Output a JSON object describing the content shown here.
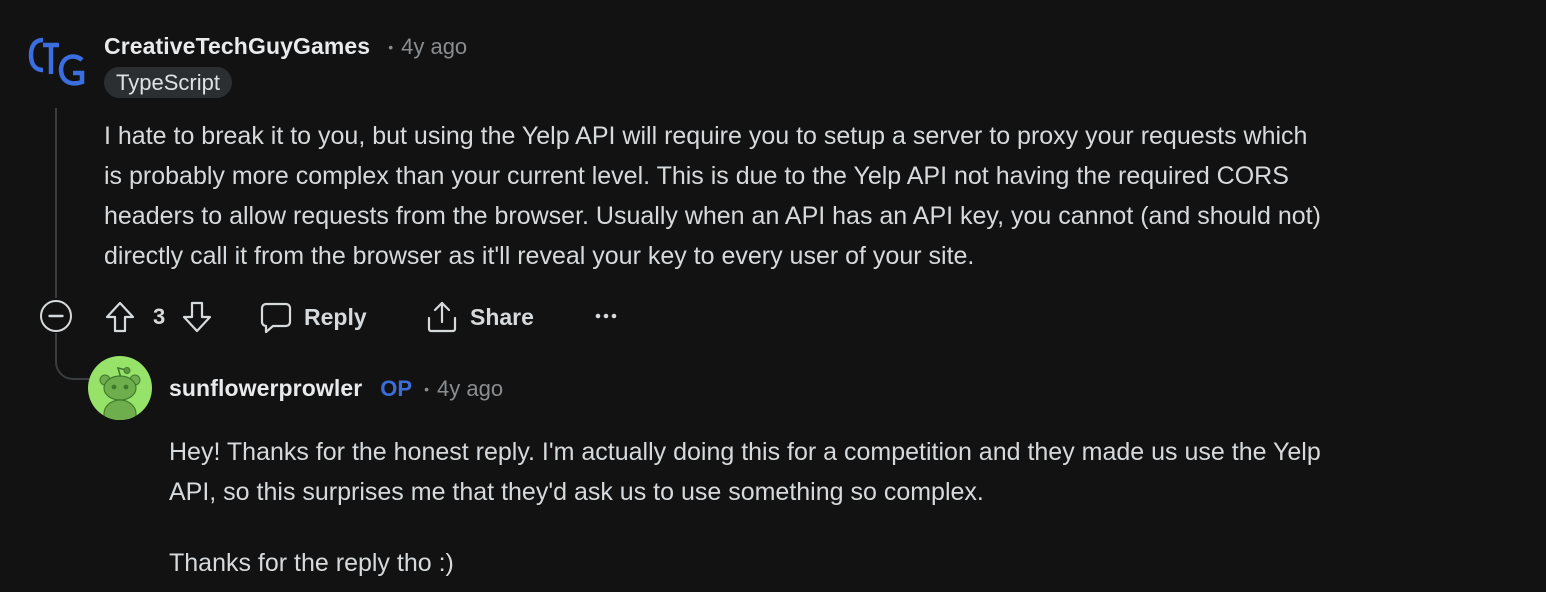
{
  "comments": [
    {
      "username": "CreativeTechGuyGames",
      "separator": "•",
      "time": "4y ago",
      "flair": "TypeScript",
      "avatar_icon": "ctg-logo-icon",
      "body_lines": [
        "I hate to break it to you, but using the Yelp API will require you to setup a server to proxy your requests which",
        "is probably more complex than your current level. This is due to the Yelp API not having the required CORS",
        "headers to allow requests from the browser. Usually when an API has an API key, you cannot (and should not)",
        "directly call it from the browser as it'll reveal your key to every user of your site."
      ],
      "actions": {
        "vote_count": "3",
        "reply_label": "Reply",
        "share_label": "Share",
        "more_icon": "ellipsis-icon"
      }
    },
    {
      "username": "sunflowerprowler",
      "op_label": "OP",
      "separator": "•",
      "time": "4y ago",
      "avatar_icon": "snoo-avatar-icon",
      "body_paragraphs": [
        [
          "Hey! Thanks for the honest reply. I'm actually doing this for a competition and they made us use the Yelp",
          "API, so this surprises me that they'd ask us to use something so complex."
        ],
        [
          "Thanks for the reply tho :)"
        ]
      ]
    }
  ],
  "colors": {
    "background": "#121212",
    "text": "#d7dadc",
    "muted": "#8a8d90",
    "op": "#3a6dd8",
    "logo_blue": "#3b6ee0",
    "avatar_bg": "#97e36a"
  }
}
